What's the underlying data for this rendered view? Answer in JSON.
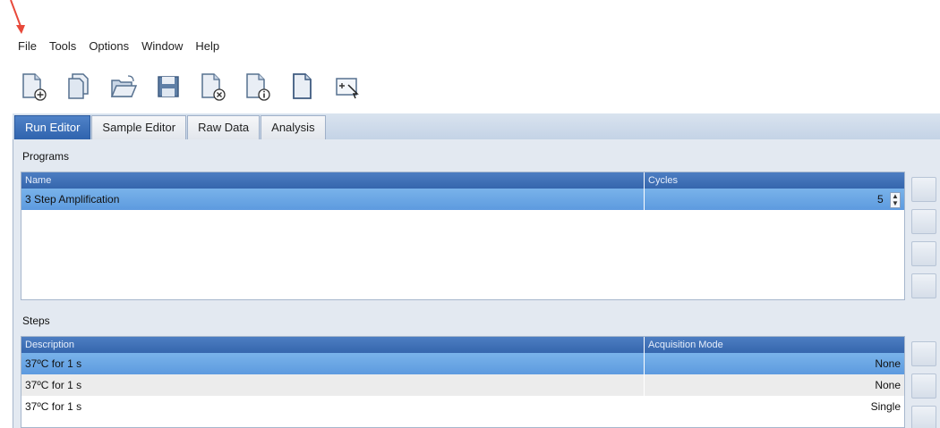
{
  "menu": [
    "File",
    "Tools",
    "Options",
    "Window",
    "Help"
  ],
  "toolbar": {
    "icons": [
      "new-document-icon",
      "copy-document-icon",
      "open-folder-icon",
      "save-icon",
      "close-document-icon",
      "info-document-icon",
      "blank-document-icon",
      "zoom-select-icon"
    ]
  },
  "tabs": [
    {
      "label": "Run Editor",
      "active": true
    },
    {
      "label": "Sample Editor",
      "active": false
    },
    {
      "label": "Raw Data",
      "active": false
    },
    {
      "label": "Analysis",
      "active": false
    }
  ],
  "programs": {
    "title": "Programs",
    "columns": [
      "Name",
      "Cycles"
    ],
    "rows": [
      {
        "name": "3 Step Amplification",
        "cycles": "5",
        "selected": true
      }
    ]
  },
  "steps": {
    "title": "Steps",
    "columns": [
      "Description",
      "Acquisition Mode"
    ],
    "rows": [
      {
        "description": "37ºC for 1 s",
        "mode": "None",
        "selected": true
      },
      {
        "description": "37ºC for 1 s",
        "mode": "None",
        "selected": false
      },
      {
        "description": "37ºC for 1 s",
        "mode": "Single",
        "selected": false
      }
    ]
  },
  "colors": {
    "active_tab": "#2f63ae",
    "header": "#3566ad",
    "selection": "#6ea8e6",
    "annotation_arrow": "#e8493a"
  }
}
